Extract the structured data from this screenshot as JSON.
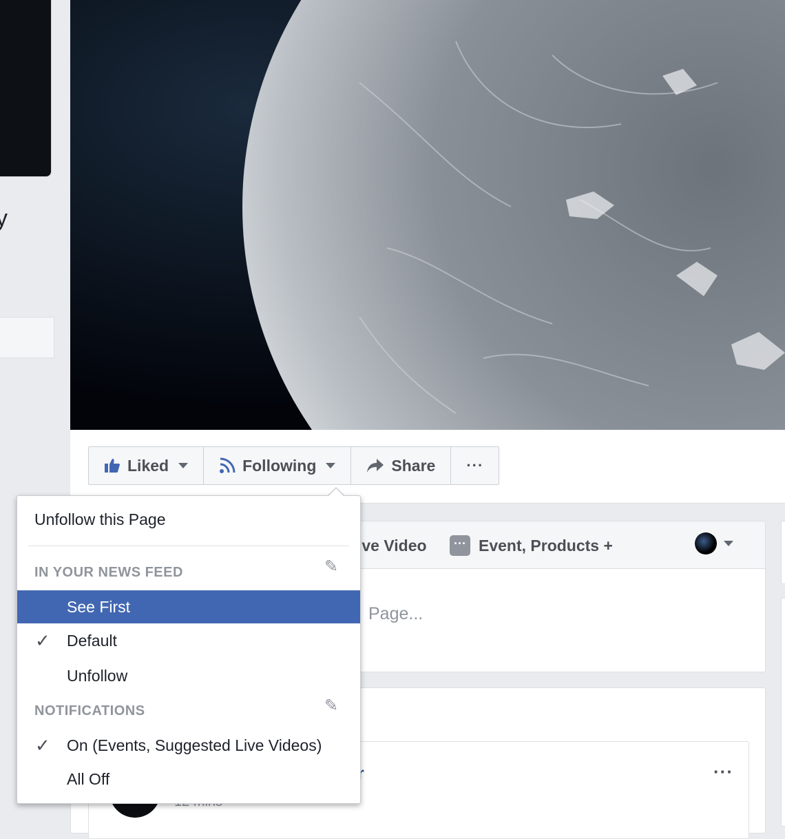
{
  "sidebar": {
    "name_fragment": "y"
  },
  "actions": {
    "liked": "Liked",
    "following": "Following",
    "share": "Share",
    "more": "···"
  },
  "composer": {
    "live_video": "ive Video",
    "event_products": "Event, Products +",
    "event_icon": "···",
    "placeholder": "Page..."
  },
  "post": {
    "author_fragment": "r",
    "time_fragment": "12 mins",
    "more": "···"
  },
  "menu": {
    "unfollow_page": "Unfollow this Page",
    "news_feed_header": "IN YOUR NEWS FEED",
    "see_first": "See First",
    "default": "Default",
    "unfollow": "Unfollow",
    "notifications_header": "NOTIFICATIONS",
    "notifications_on": "On (Events, Suggested Live Videos)",
    "all_off": "All Off",
    "checkmark": "✓",
    "pencil": "✎"
  },
  "colors": {
    "accent": "#4267b2",
    "link": "#365899",
    "muted": "#90949c",
    "page_bg": "#e9ebee"
  }
}
